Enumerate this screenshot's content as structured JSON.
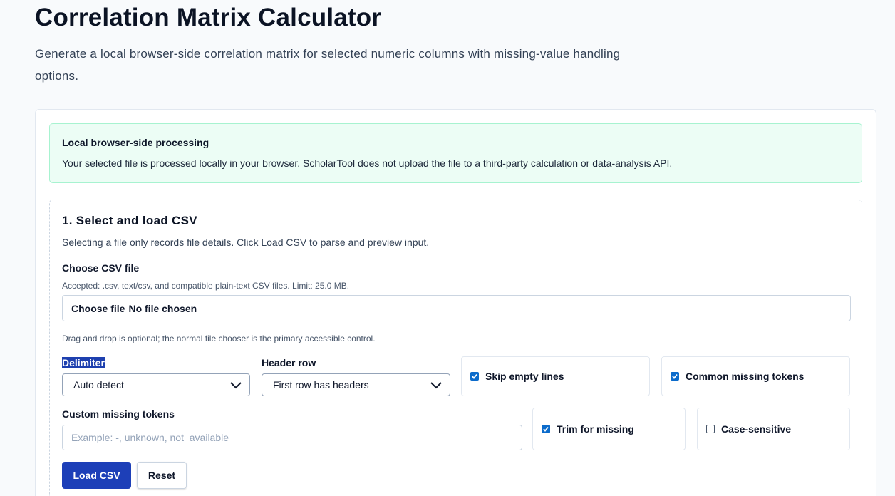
{
  "header": {
    "title": "Correlation Matrix Calculator",
    "description": "Generate a local browser-side correlation matrix for selected numeric columns with missing-value handling options."
  },
  "notice": {
    "title": "Local browser-side processing",
    "text": "Your selected file is processed locally in your browser. ScholarTool does not upload the file to a third-party calculation or data-analysis API."
  },
  "section": {
    "title": "1. Select and load CSV",
    "description": "Selecting a file only records file details. Click Load CSV to parse and preview input.",
    "file_label": "Choose CSV file",
    "file_hint": "Accepted: .csv, text/csv, and compatible plain-text CSV files. Limit: 25.0 MB.",
    "file_button": "Choose file",
    "file_status": "No file chosen",
    "drag_hint": "Drag and drop is optional; the normal file chooser is the primary accessible control.",
    "delimiter_label": "Delimiter",
    "delimiter_value": "Auto detect",
    "header_label": "Header row",
    "header_value": "First row has headers",
    "skip_empty_label": "Skip empty lines",
    "skip_empty_checked": true,
    "common_missing_label": "Common missing tokens",
    "common_missing_checked": true,
    "custom_missing_label": "Custom missing tokens",
    "custom_missing_placeholder": "Example: -, unknown, not_available",
    "trim_label": "Trim for missing",
    "trim_checked": true,
    "case_label": "Case-sensitive",
    "case_checked": false,
    "load_button": "Load CSV",
    "reset_button": "Reset"
  },
  "colors": {
    "primary": "#1d3fb8",
    "checkbox": "#0b6bcb",
    "notice_bg": "#ecfdf5",
    "notice_border": "#a7f3d0"
  }
}
